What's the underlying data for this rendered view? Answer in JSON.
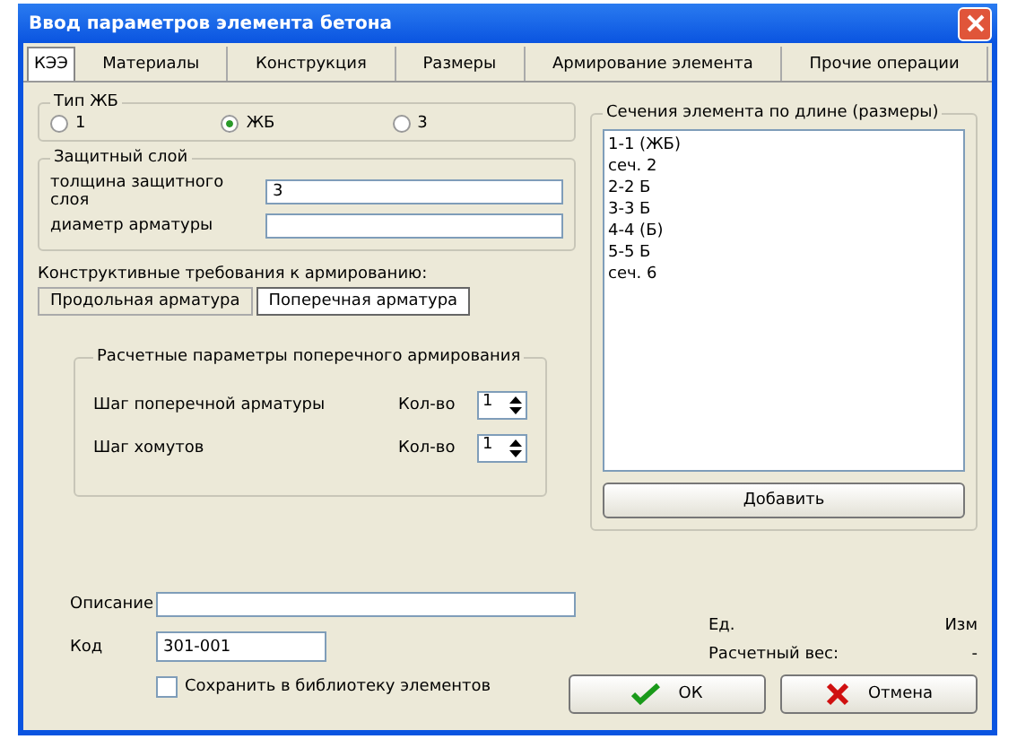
{
  "window": {
    "title": "Ввод параметров элемента бетона"
  },
  "tabs": [
    {
      "label": "КЭЭ",
      "selected": true
    },
    {
      "label": "Материалы",
      "selected": false
    },
    {
      "label": "Конструкция",
      "selected": false
    },
    {
      "label": "Размеры",
      "selected": false
    },
    {
      "label": "Армирование элемента",
      "selected": false
    },
    {
      "label": "Прочие операции",
      "selected": false
    }
  ],
  "type_group": {
    "title": "Тип ЖБ",
    "options": [
      {
        "label": "1",
        "selected": false
      },
      {
        "label": "ЖБ",
        "selected": true
      },
      {
        "label": "3",
        "selected": false
      }
    ]
  },
  "cover_group": {
    "title": "Защитный слой",
    "fields": [
      {
        "label": "толщина защитного слоя",
        "value": "3"
      },
      {
        "label": "диаметр арматуры"
      }
    ]
  },
  "requirements_label": "Конструктивные требования к армированию:",
  "subtabs": [
    {
      "label": "Продольная арматура",
      "selected": false
    },
    {
      "label": "Поперечная арматура",
      "selected": true
    }
  ],
  "calc_group": {
    "title": "Расчетные параметры поперечного армирования",
    "rows": [
      {
        "label": "Шаг поперечной арматуры",
        "unit": "Кол-во",
        "value": "1"
      },
      {
        "label": "Шаг хомутов",
        "unit": "Кол-во",
        "value": "1"
      }
    ]
  },
  "sections_group": {
    "title": "Сечения элемента по длине (размеры)",
    "items": [
      "1-1 (ЖБ)",
      "сеч. 2",
      "2-2 Б",
      "3-3 Б",
      "4-4 (Б)",
      "5-5 Б",
      "сеч. 6"
    ],
    "button": "Добавить"
  },
  "description": {
    "label": "Описание"
  },
  "code": {
    "label": "Код",
    "value": "301-001"
  },
  "save_checkbox": {
    "label": "Сохранить в библиотеку элементов",
    "checked": false
  },
  "info": [
    {
      "label": "Ед.",
      "value": "Изм"
    },
    {
      "label": "Расчетный вес:",
      "value": "-"
    }
  ],
  "ok_button": "ОК",
  "cancel_button": "Отмена"
}
